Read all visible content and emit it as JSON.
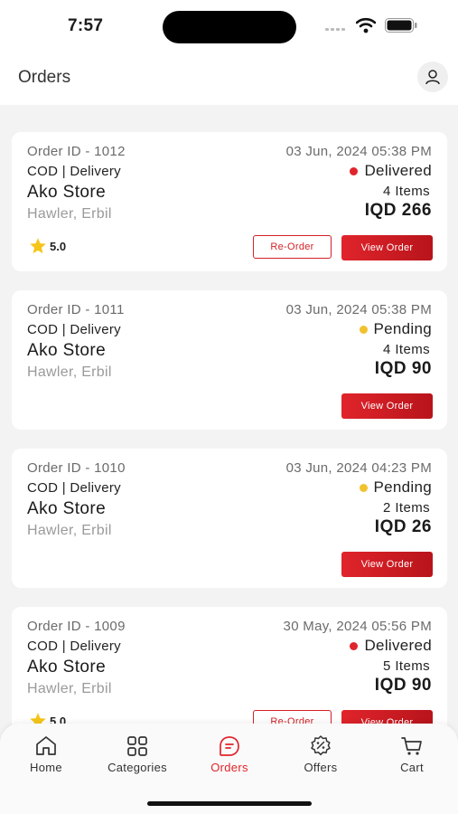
{
  "statusbar": {
    "time": "7:57"
  },
  "header": {
    "title": "Orders"
  },
  "colors": {
    "accent": "#e0242b",
    "delivered": "#e0242b",
    "pending": "#f2c12e",
    "star": "#f5c518"
  },
  "orders": [
    {
      "id_label": "Order ID - 1012",
      "type": "COD | Delivery",
      "store": "Ako Store",
      "address": "Hawler, Erbil",
      "date": "03 Jun, 2024 05:38 PM",
      "status": "Delivered",
      "items": "4 Items",
      "price": "IQD 266",
      "rating": "5.0",
      "reorder_label": "Re-Order",
      "view_label": "View Order"
    },
    {
      "id_label": "Order ID - 1011",
      "type": "COD | Delivery",
      "store": "Ako Store",
      "address": "Hawler, Erbil",
      "date": "03 Jun, 2024 05:38 PM",
      "status": "Pending",
      "items": "4 Items",
      "price": "IQD 90",
      "view_label": "View Order"
    },
    {
      "id_label": "Order ID - 1010",
      "type": "COD | Delivery",
      "store": "Ako Store",
      "address": "Hawler, Erbil",
      "date": "03 Jun, 2024 04:23 PM",
      "status": "Pending",
      "items": "2 Items",
      "price": "IQD 26",
      "view_label": "View Order"
    },
    {
      "id_label": "Order ID - 1009",
      "type": "COD | Delivery",
      "store": "Ako Store",
      "address": "Hawler, Erbil",
      "date": "30 May, 2024 05:56 PM",
      "status": "Delivered",
      "items": "5 Items",
      "price": "IQD 90",
      "rating": "5.0",
      "reorder_label": "Re-Order",
      "view_label": "View Order"
    }
  ],
  "tabs": [
    {
      "label": "Home",
      "icon": "home-icon"
    },
    {
      "label": "Categories",
      "icon": "categories-icon"
    },
    {
      "label": "Orders",
      "icon": "orders-icon",
      "active": true
    },
    {
      "label": "Offers",
      "icon": "offers-icon"
    },
    {
      "label": "Cart",
      "icon": "cart-icon"
    }
  ]
}
